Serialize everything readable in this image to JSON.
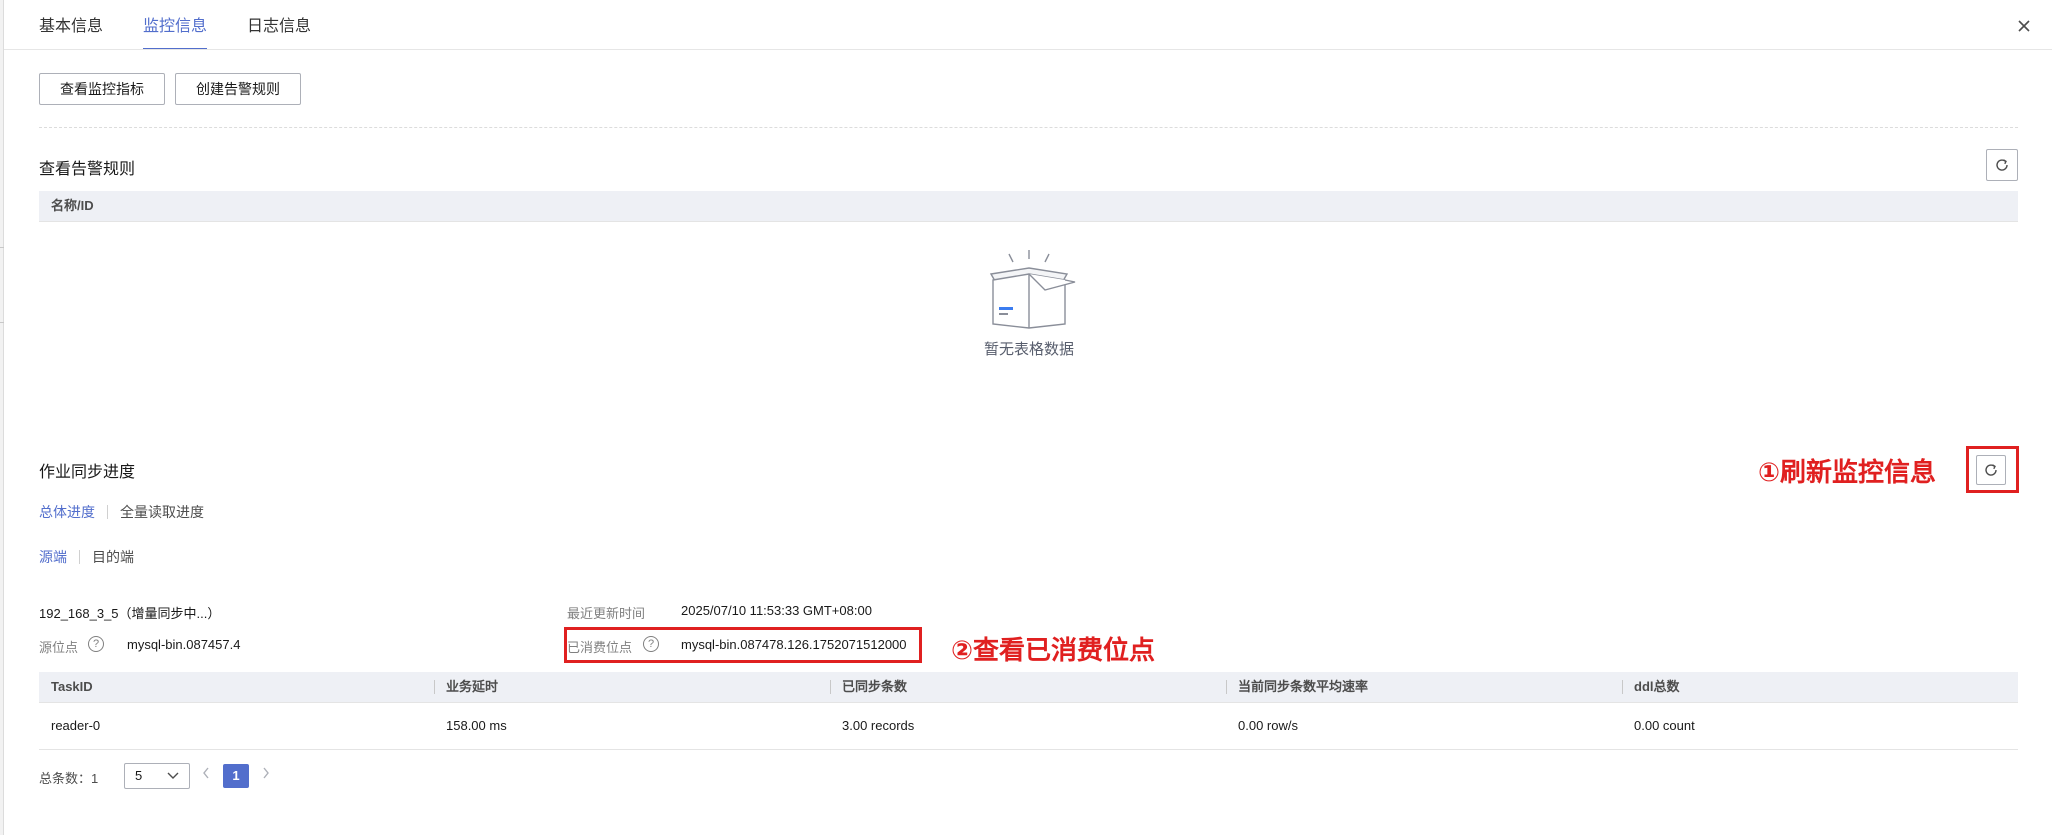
{
  "tabs": [
    "基本信息",
    "监控信息",
    "日志信息"
  ],
  "toolbar": {
    "view_metrics": "查看监控指标",
    "create_alarm_rule": "创建告警规则"
  },
  "alarm_rules": {
    "title": "查看告警规则",
    "columns": [
      "名称/ID"
    ],
    "empty_text": "暂无表格数据"
  },
  "sync_progress": {
    "title": "作业同步进度",
    "progress_tabs": [
      "总体进度",
      "全量读取进度"
    ],
    "endpoint_tabs": [
      "源端",
      "目的端"
    ],
    "source_name": "192_168_3_5（增量同步中...）",
    "source_position_label": "源位点",
    "source_position": "mysql-bin.087457.4",
    "last_update_label": "最近更新时间",
    "last_update": "2025/07/10 11:53:33 GMT+08:00",
    "consumed_position_label": "已消费位点",
    "consumed_position": "mysql-bin.087478.126.1752071512000",
    "columns": [
      "TaskID",
      "业务延时",
      "已同步条数",
      "当前同步条数平均速率",
      "ddl总数"
    ],
    "rows": [
      [
        "reader-0",
        "158.00 ms",
        "3.00 records",
        "0.00 row/s",
        "0.00 count"
      ]
    ]
  },
  "pagination": {
    "total_label": "总条数：1",
    "page_size": "5",
    "current_page": "1"
  },
  "annotations": {
    "refresh": "①刷新监控信息",
    "consumed": "②查看已消费位点"
  },
  "colors": {
    "accent": "#526ecc",
    "annotation": "#e02020",
    "header_bg": "#eef0f5"
  },
  "icons": [
    "close-icon",
    "refresh-icon",
    "empty-box-icon",
    "help-icon",
    "chevron-down-icon",
    "chevron-left-icon",
    "chevron-right-icon"
  ]
}
